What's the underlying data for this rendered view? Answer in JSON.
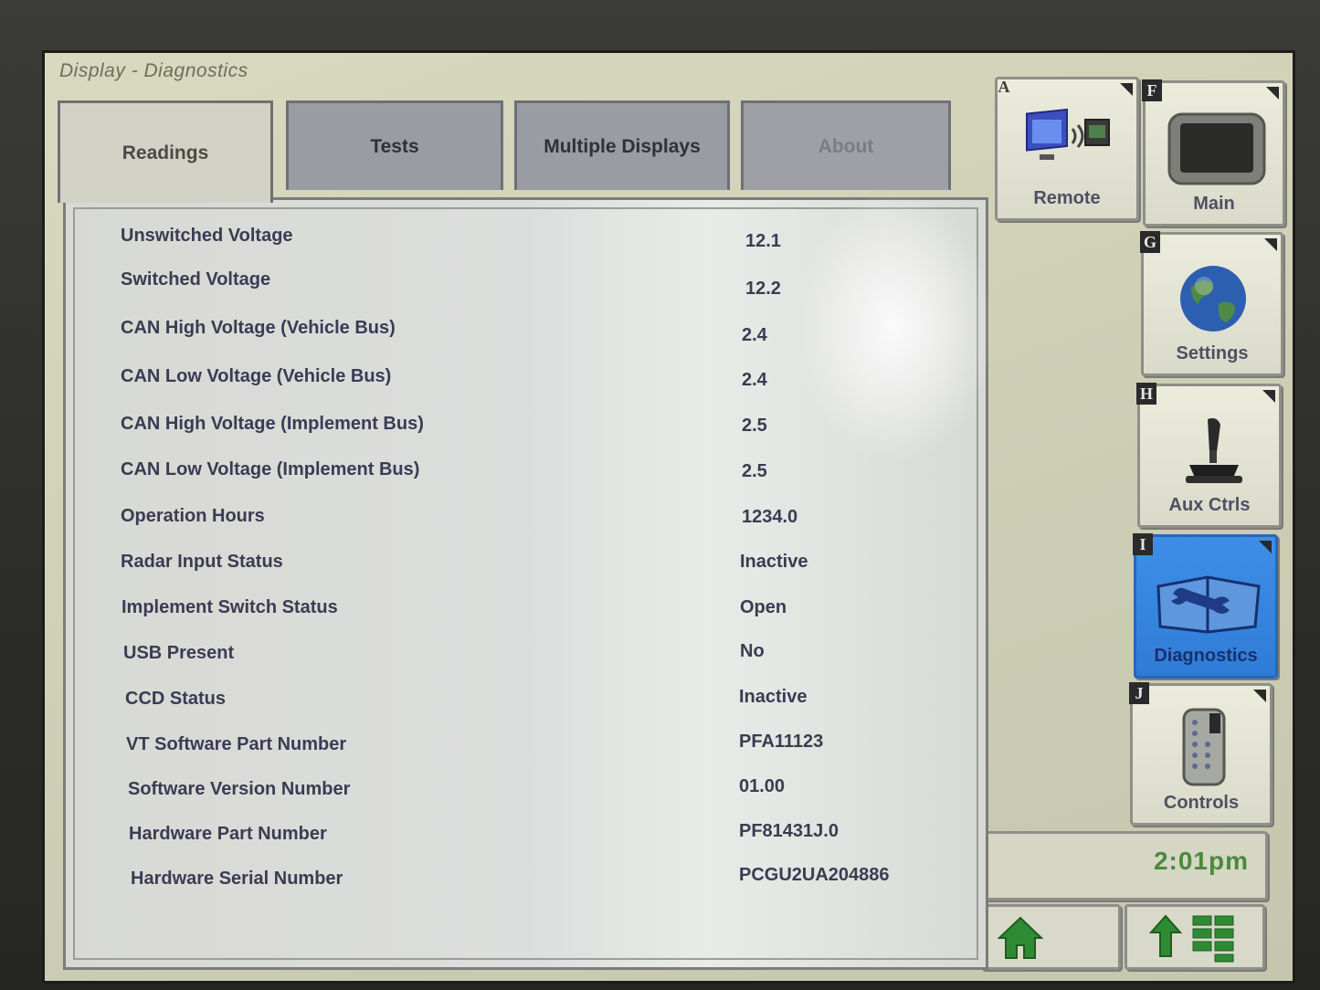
{
  "window": {
    "title": "Display - Diagnostics"
  },
  "tabs": [
    {
      "label": "Readings",
      "state": "active"
    },
    {
      "label": "Tests",
      "state": "inactive"
    },
    {
      "label": "Multiple Displays",
      "state": "inactive"
    },
    {
      "label": "About",
      "state": "disabled"
    }
  ],
  "readings": [
    {
      "label": "Unswitched Voltage",
      "value": "12.1"
    },
    {
      "label": "Switched Voltage",
      "value": "12.2"
    },
    {
      "label": "CAN High Voltage (Vehicle Bus)",
      "value": "2.4"
    },
    {
      "label": "CAN Low Voltage (Vehicle Bus)",
      "value": "2.4"
    },
    {
      "label": "CAN High Voltage (Implement Bus)",
      "value": "2.5"
    },
    {
      "label": "CAN Low Voltage (Implement Bus)",
      "value": "2.5"
    },
    {
      "label": "Operation Hours",
      "value": "1234.0"
    },
    {
      "label": "Radar Input Status",
      "value": "Inactive"
    },
    {
      "label": "Implement Switch Status",
      "value": "Open"
    },
    {
      "label": "USB Present",
      "value": "No"
    },
    {
      "label": "CCD Status",
      "value": "Inactive"
    },
    {
      "label": "VT Software Part Number",
      "value": "PFA11123"
    },
    {
      "label": "Software Version Number",
      "value": "01.00"
    },
    {
      "label": "Hardware Part Number",
      "value": "PF81431J.0"
    },
    {
      "label": "Hardware Serial Number",
      "value": "PCGU2UA204886"
    }
  ],
  "softkeys": [
    {
      "key": "A",
      "label": "Remote",
      "icon": "remote-monitor-icon"
    },
    {
      "key": "F",
      "label": "Main",
      "icon": "display-screen-icon"
    },
    {
      "key": "G",
      "label": "Settings",
      "icon": "globe-icon"
    },
    {
      "key": "H",
      "label": "Aux Ctrls",
      "icon": "joystick-icon"
    },
    {
      "key": "I",
      "label": "Diagnostics",
      "icon": "wrench-book-icon",
      "selected": true
    },
    {
      "key": "J",
      "label": "Controls",
      "icon": "keypad-remote-icon"
    }
  ],
  "status": {
    "time": "2:01pm"
  },
  "bottom_buttons": [
    {
      "icon": "home-icon"
    },
    {
      "icon": "up-arrow-grid-icon"
    }
  ],
  "colors": {
    "selected": "#3f8ee6",
    "clock_text": "#4b8a3c",
    "home_icon": "#2f8a34"
  }
}
